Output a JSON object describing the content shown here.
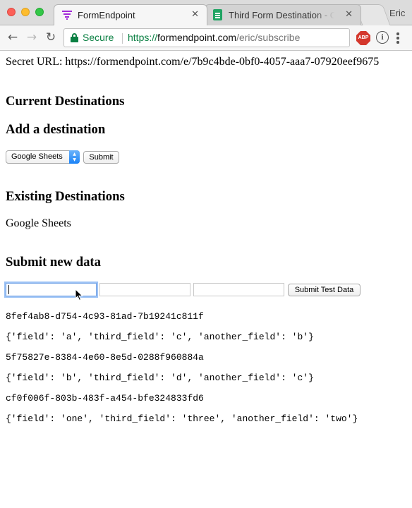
{
  "browser": {
    "tabs": [
      {
        "title": "FormEndpoint",
        "favicon": "formendpoint-funnel-icon",
        "active": true
      },
      {
        "title": "Third Form Destination - Goo",
        "favicon": "google-sheets-icon",
        "active": false
      }
    ],
    "profile_name": "Eric",
    "security_label": "Secure",
    "url": {
      "scheme": "https://",
      "host": "formendpoint.com",
      "path": "/eric/subscribe"
    },
    "extensions": {
      "adblock_label": "ABP"
    },
    "colors": {
      "secure_green": "#0b8043",
      "sheets_green": "#1fa463",
      "tab_accent": "#a22ad8"
    }
  },
  "page": {
    "secret_url": "Secret URL: https://formendpoint.com/e/7b9c4bde-0bf0-4057-aaa7-07920eef9675",
    "current_destinations_heading": "Current Destinations",
    "add_destination": {
      "heading": "Add a destination",
      "selected_option": "Google Sheets",
      "submit_label": "Submit"
    },
    "existing_destinations": {
      "heading": "Existing Destinations",
      "items": [
        "Google Sheets"
      ]
    },
    "submit_new_data": {
      "heading": "Submit new data",
      "fields": [
        {
          "value": "",
          "placeholder": ""
        },
        {
          "value": "",
          "placeholder": ""
        },
        {
          "value": "",
          "placeholder": ""
        }
      ],
      "button_label": "Submit Test Data"
    },
    "results": [
      {
        "id": "8fef4ab8-d754-4c93-81ad-7b19241c811f",
        "payload": "{'field': 'a', 'third_field': 'c', 'another_field': 'b'}"
      },
      {
        "id": "5f75827e-8384-4e60-8e5d-0288f960884a",
        "payload": "{'field': 'b', 'third_field': 'd', 'another_field': 'c'}"
      },
      {
        "id": "cf0f006f-803b-483f-a454-bfe324833fd6",
        "payload": "{'field': 'one', 'third_field': 'three', 'another_field': 'two'}"
      }
    ]
  }
}
